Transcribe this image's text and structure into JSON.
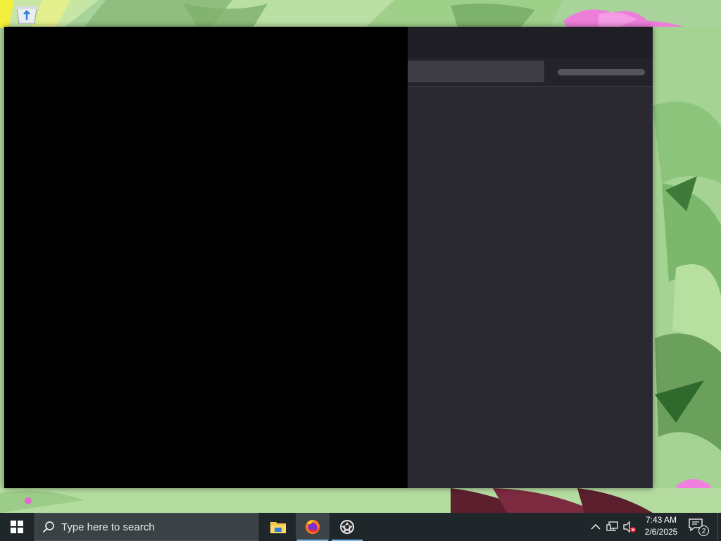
{
  "desktop": {
    "icons": [
      {
        "name": "recycle-bin-icon"
      }
    ]
  },
  "app_window": {
    "address_field": {
      "value": ""
    },
    "progress": {
      "fraction": 0.0
    },
    "colors": {
      "left_pane": "#000000",
      "titlebar": "#1f1e24",
      "content": "#2a292f"
    }
  },
  "taskbar": {
    "start_icon": "windows-logo-icon",
    "search": {
      "placeholder": "Type here to search"
    },
    "apps": [
      {
        "name": "file-explorer-icon",
        "active": false,
        "running": false
      },
      {
        "name": "firefox-icon",
        "active": true,
        "running": true
      },
      {
        "name": "app-circle-icon",
        "active": false,
        "running": true
      }
    ],
    "tray": {
      "icons": [
        "chevron-up-icon",
        "network-icon",
        "volume-muted-icon"
      ],
      "time": "7:43 AM",
      "date": "2/6/2025",
      "notifications": "2"
    },
    "accent": "#76b9ed"
  }
}
